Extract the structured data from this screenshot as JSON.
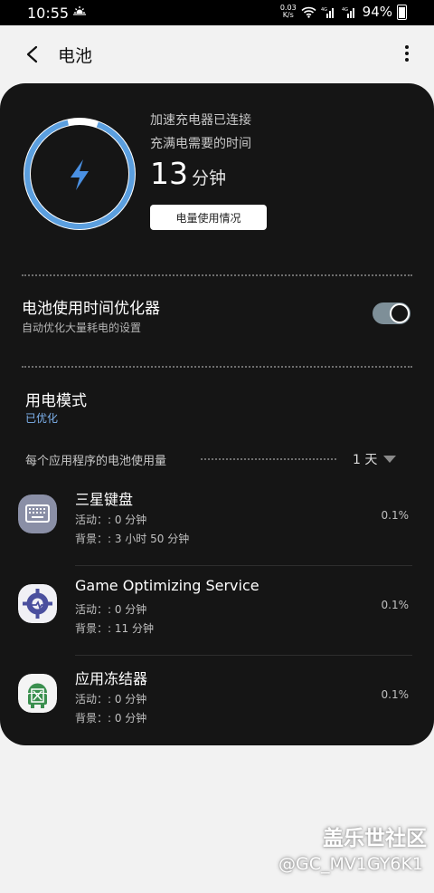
{
  "status_bar": {
    "time": "10:55",
    "net_speed_value": "0.03",
    "net_speed_unit": "K/s",
    "battery_percent": "94%"
  },
  "header": {
    "title": "电池"
  },
  "charging": {
    "line1": "加速充电器已连接",
    "line2": "充满电需要的时间",
    "time_value": "13",
    "time_unit": "分钟",
    "usage_button": "电量使用情况",
    "ring_color": "#5b9fdf",
    "bolt_color": "#4a90e2"
  },
  "optimizer": {
    "title": "电池使用时间优化器",
    "subtitle": "自动优化大量耗电的设置",
    "enabled": true
  },
  "power_mode": {
    "title": "用电模式",
    "value": "已优化"
  },
  "per_app": {
    "label": "每个应用程序的电池使用量",
    "period": "1 天"
  },
  "apps": [
    {
      "name": "三星键盘",
      "active": "活动：: 0 分钟",
      "background": "背景：: 3 小时 50 分钟",
      "percent": "0.1%",
      "icon": "keyboard-icon"
    },
    {
      "name": "Game Optimizing Service",
      "active": "活动：: 0 分钟",
      "background": "背景：: 11 分钟",
      "percent": "0.1%",
      "icon": "game-optimizer-icon"
    },
    {
      "name": "应用冻结器",
      "active": "活动：: 0 分钟",
      "background": "背景：: 0 分钟",
      "percent": "0.1%",
      "icon": "app-freezer-icon"
    }
  ],
  "watermark": {
    "brand": "盖乐世社区",
    "user": "@GC_MV1GY6K1"
  }
}
